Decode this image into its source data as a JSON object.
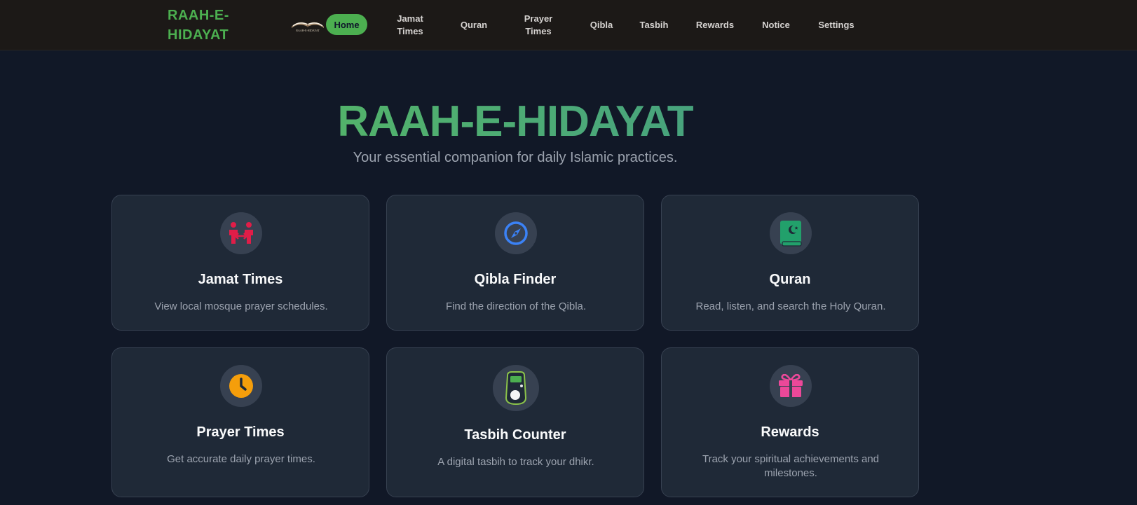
{
  "header": {
    "brand_line1": "RAAH-E-",
    "brand_line2": "HIDAYAT",
    "logo_caption": "RAAH-E-HIDAYAT",
    "nav": {
      "home": "Home",
      "jamat_line1": "Jamat",
      "jamat_line2": "Times",
      "quran": "Quran",
      "prayer_line1": "Prayer",
      "prayer_line2": "Times",
      "qibla": "Qibla",
      "tasbih": "Tasbih",
      "rewards": "Rewards",
      "notice": "Notice",
      "settings": "Settings"
    }
  },
  "hero": {
    "title": "RAAH-E-HIDAYAT",
    "subtitle": "Your essential companion for daily Islamic practices."
  },
  "cards": [
    {
      "title": "Jamat Times",
      "desc": "View local mosque prayer schedules.",
      "icon": "people-arrows-icon",
      "color": "#e11d48"
    },
    {
      "title": "Qibla Finder",
      "desc": "Find the direction of the Qibla.",
      "icon": "compass-icon",
      "color": "#3b82f6"
    },
    {
      "title": "Quran",
      "desc": "Read, listen, and search the Holy Quran.",
      "icon": "quran-book-icon",
      "color": "#22a06b"
    },
    {
      "title": "Prayer Times",
      "desc": "Get accurate daily prayer times.",
      "icon": "clock-icon",
      "color": "#f59e0b"
    },
    {
      "title": "Tasbih Counter",
      "desc": "A digital tasbih to track your dhikr.",
      "icon": "tasbih-counter-icon",
      "color": "#4caf50"
    },
    {
      "title": "Rewards",
      "desc": "Track your spiritual achievements and milestones.",
      "icon": "gift-icon",
      "color": "#ec4899"
    }
  ],
  "colors": {
    "accent": "#4caf50",
    "background": "#111827",
    "card": "#1f2937",
    "header": "#1c1917"
  }
}
